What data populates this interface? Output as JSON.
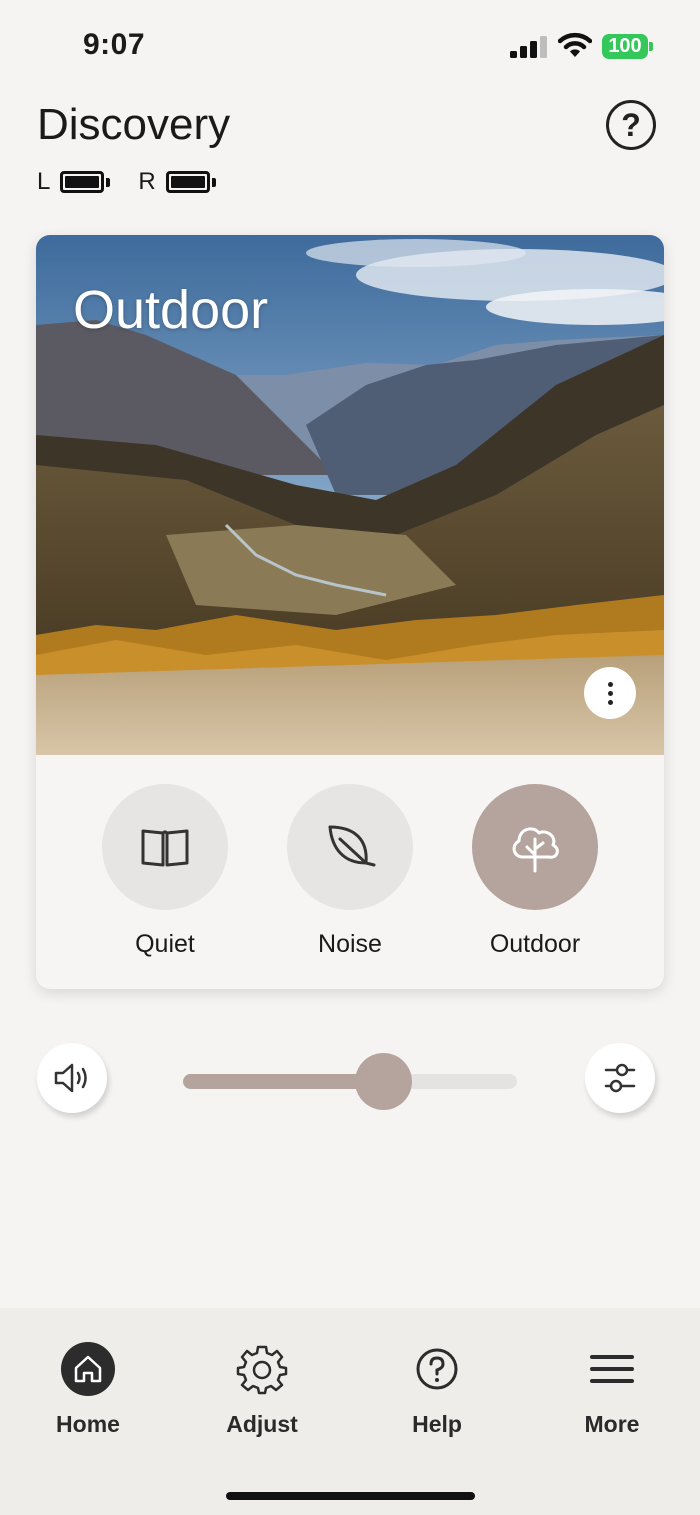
{
  "status_bar": {
    "time": "9:07",
    "battery": "100"
  },
  "header": {
    "title": "Discovery",
    "left_label": "L",
    "right_label": "R"
  },
  "program_card": {
    "title": "Outdoor",
    "programs": [
      {
        "label": "Quiet",
        "icon": "book-icon",
        "active": false
      },
      {
        "label": "Noise",
        "icon": "leaf-icon",
        "active": false
      },
      {
        "label": "Outdoor",
        "icon": "tree-icon",
        "active": true
      }
    ]
  },
  "volume": {
    "level_percent": 60
  },
  "bottom_nav": {
    "items": [
      {
        "label": "Home",
        "icon": "home-icon",
        "active": true
      },
      {
        "label": "Adjust",
        "icon": "gear-icon",
        "active": false
      },
      {
        "label": "Help",
        "icon": "help-icon",
        "active": false
      },
      {
        "label": "More",
        "icon": "menu-icon",
        "active": false
      }
    ]
  },
  "colors": {
    "accent": "#b5a49d",
    "battery_green": "#34c759",
    "background": "#f6f4f2"
  }
}
